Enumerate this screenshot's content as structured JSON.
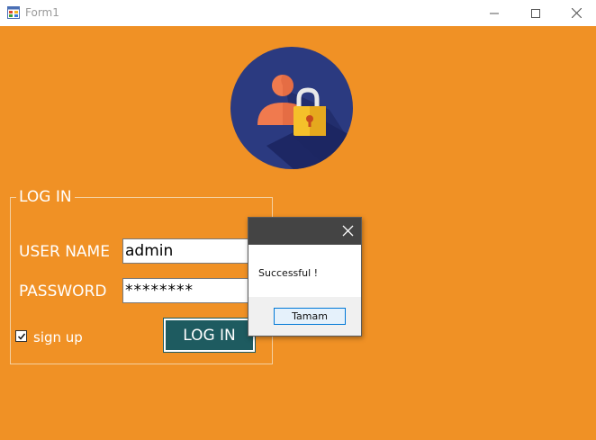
{
  "window": {
    "title": "Form1",
    "icons": {
      "app": "form-app-icon",
      "minimize": "minimize-icon",
      "maximize": "maximize-icon",
      "close": "close-icon"
    }
  },
  "colors": {
    "form_background": "#f09125",
    "avatar_circle": "#2b3a80",
    "login_button": "#1e5b60",
    "message_header": "#444444"
  },
  "login": {
    "group_title": "LOG IN",
    "username_label": "USER NAME",
    "username_value": "admin",
    "password_label": "PASSWORD",
    "password_value": "********",
    "signup_label": "sign up",
    "signup_checked": true,
    "login_button": "LOG IN",
    "avatar_icon": "user-lock-icon"
  },
  "message_box": {
    "text": "Successful !",
    "ok_button": "Tamam",
    "close_icon": "close-icon"
  }
}
